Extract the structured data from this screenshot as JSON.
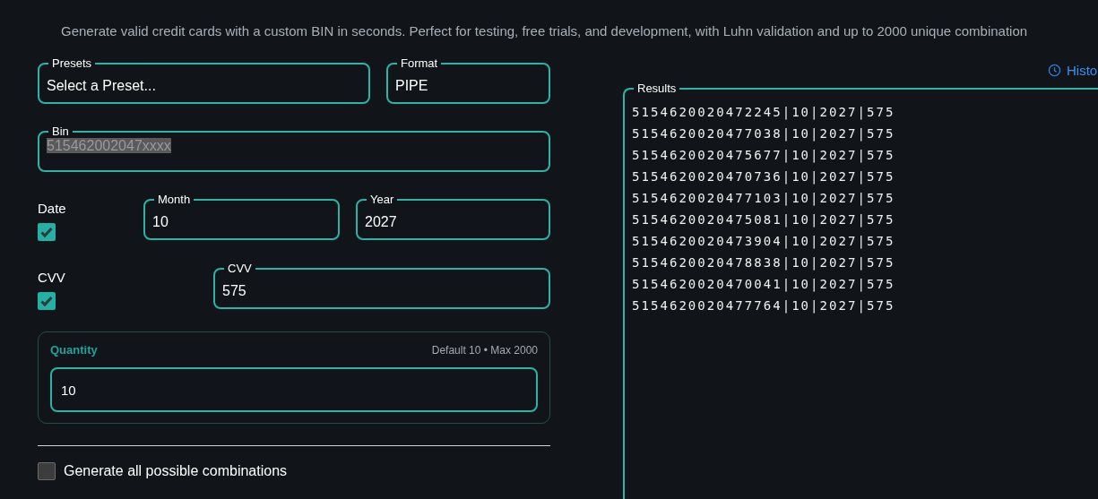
{
  "subtitle": "Generate valid credit cards with a custom BIN in seconds. Perfect for testing, free trials, and development, with Luhn validation and up to 2000 unique combination",
  "history_link": "Histo",
  "presets": {
    "label": "Presets",
    "value": "Select a Preset..."
  },
  "format": {
    "label": "Format",
    "value": "PIPE"
  },
  "bin": {
    "label": "Bin",
    "value": "515462002047xxxx",
    "highlighted": true
  },
  "date": {
    "label": "Date",
    "checked": true,
    "month": {
      "label": "Month",
      "value": "10"
    },
    "year": {
      "label": "Year",
      "value": "2027"
    }
  },
  "cvv": {
    "label": "CVV",
    "checked": true,
    "field": {
      "label": "CVV",
      "value": "575"
    }
  },
  "quantity": {
    "label": "Quantity",
    "hint": "Default 10 • Max 2000",
    "value": "10"
  },
  "all_combinations": {
    "label": "Generate all possible combinations",
    "checked": false
  },
  "results": {
    "label": "Results",
    "lines": [
      "5154620020472245|10|2027|575",
      "5154620020477038|10|2027|575",
      "5154620020475677|10|2027|575",
      "5154620020470736|10|2027|575",
      "5154620020477103|10|2027|575",
      "5154620020475081|10|2027|575",
      "5154620020473904|10|2027|575",
      "5154620020478838|10|2027|575",
      "5154620020470041|10|2027|575",
      "5154620020477764|10|2027|575"
    ]
  }
}
